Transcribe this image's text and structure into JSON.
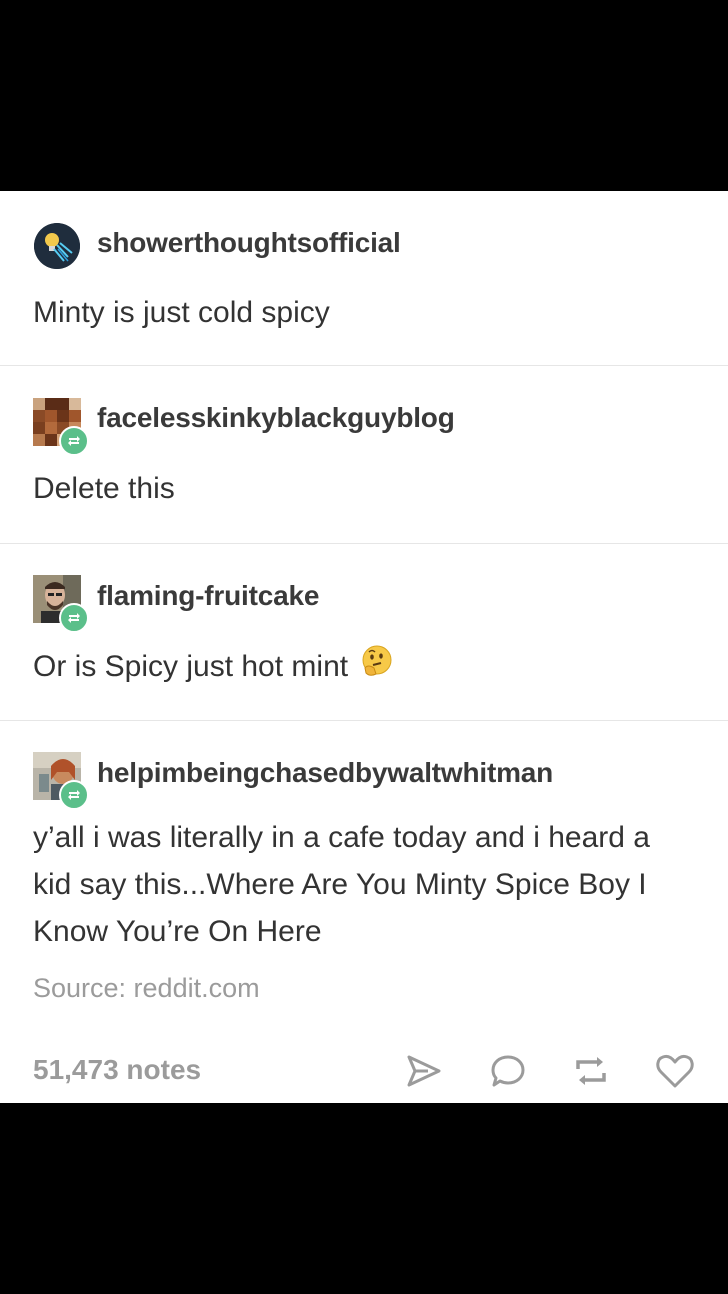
{
  "posts": [
    {
      "username": "showerthoughtsofficial",
      "text": "Minty is just cold spicy",
      "avatar_icon": "lightbulb-shower-icon"
    },
    {
      "username": "facelesskinkyblackguyblog",
      "text": "Delete this",
      "avatar_icon": "pixelated-face-avatar",
      "reblog": true
    },
    {
      "username": "flaming-fruitcake",
      "text": "Or is Spicy just hot mint",
      "emoji": "🤔",
      "avatar_icon": "man-photo-avatar",
      "reblog": true
    },
    {
      "username": "helpimbeingchasedbywaltwhitman",
      "text_lines": [
        "y’all i was literally in a cafe today and i heard a",
        "kid say this...Where Are You Minty Spice Boy I",
        "Know You’re On Here"
      ],
      "avatar_icon": "woman-photo-avatar",
      "reblog": true
    }
  ],
  "source": "Source: reddit.com",
  "notes": "51,473 notes",
  "actions": {
    "share_icon": "share-arrow-icon",
    "reply_icon": "speech-bubble-icon",
    "reblog_icon": "reblog-icon",
    "like_icon": "heart-icon"
  },
  "colors": {
    "reblog_green": "#5bbf8a",
    "text": "#333333",
    "muted": "#9b9b9b"
  }
}
